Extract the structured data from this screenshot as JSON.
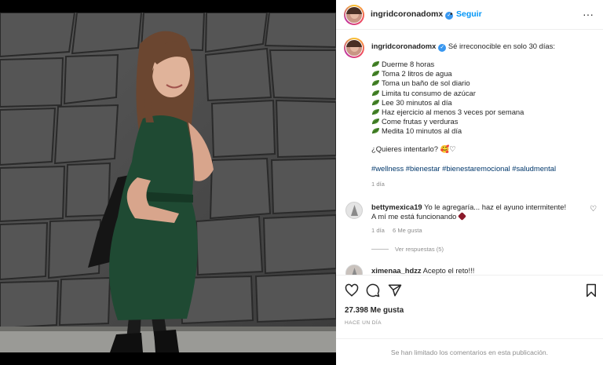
{
  "post": {
    "username": "ingridcoronadomx",
    "verified_glyph": "✓",
    "dot": "•",
    "follow_label": "Seguir",
    "more_icon": "more-horizontal-icon",
    "more_glyph": "···"
  },
  "caption": {
    "username": "ingridcoronadomx",
    "intro": "Sé irreconocible en solo 30 días:",
    "items": [
      "Duerme 8 horas",
      "Toma 2 litros de agua",
      "Toma un baño de sol diario",
      "Limita tu consumo de azúcar",
      "Lee 30 minutos al día",
      "Haz ejercicio al menos 3 veces por semana",
      "Come frutas y verduras",
      "Medita 10 minutos al día"
    ],
    "question": "¿Quieres intentarlo? 🥰♡",
    "hashtags": "#wellness #bienestar #bienestaremocional #saludmental",
    "time": "1 día"
  },
  "comments": [
    {
      "username": "bettymexica19",
      "text_line1": "Yo le agregaría... haz el ayuno intermitente!",
      "text_line2": "A mí me está funcionando",
      "time": "1 día",
      "likes": "6 Me gusta",
      "heart_glyph": "♡",
      "view_replies": "Ver respuestas (5)"
    },
    {
      "username": "ximenaa_hdzz",
      "text": "Acepto el reto!!!"
    }
  ],
  "actions": {
    "icons": [
      "heart-icon",
      "comment-icon",
      "share-icon",
      "bookmark-icon"
    ],
    "likes": "27.398 Me gusta",
    "posted": "HACE UN DÍA",
    "limited_notice": "Se han limitado los comentarios en esta publicación."
  },
  "colors": {
    "link": "#0095f6",
    "hashtag": "#00376b",
    "muted": "#8e8e8e",
    "dress": "#1f4a33",
    "wall": "#4d4d4d"
  }
}
